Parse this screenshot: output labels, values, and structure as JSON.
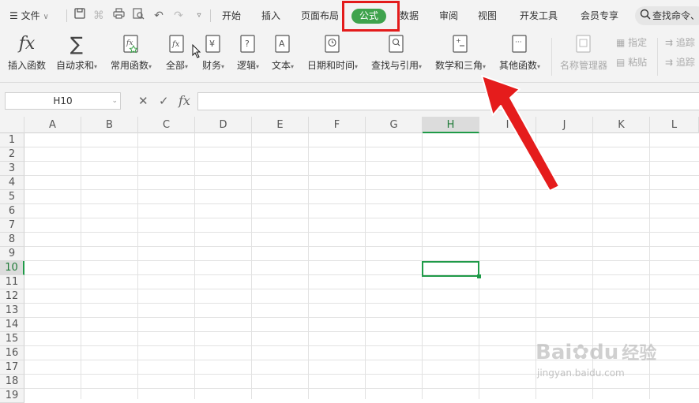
{
  "menubar": {
    "file_label": "文件",
    "tabs": [
      "开始",
      "插入",
      "页面布局",
      "公式",
      "数据",
      "审阅",
      "视图",
      "开发工具",
      "会员专享"
    ],
    "active_tab": "公式",
    "search_placeholder": "查找命令、"
  },
  "ribbon": {
    "groups": [
      {
        "label": "插入函数",
        "icon": "fx-icon"
      },
      {
        "label": "自动求和",
        "icon": "sigma-icon"
      },
      {
        "label": "常用函数",
        "icon": "star-function-icon"
      },
      {
        "label": "全部",
        "icon": "fx-book-icon"
      },
      {
        "label": "财务",
        "icon": "yen-book-icon"
      },
      {
        "label": "逻辑",
        "icon": "question-book-icon"
      },
      {
        "label": "文本",
        "icon": "letter-a-book-icon"
      },
      {
        "label": "日期和时间",
        "icon": "clock-book-icon"
      },
      {
        "label": "查找与引用",
        "icon": "search-book-icon"
      },
      {
        "label": "数学和三角",
        "icon": "math-book-icon"
      },
      {
        "label": "其他函数",
        "icon": "dots-book-icon"
      }
    ],
    "name_manager": "名称管理器",
    "specify": "指定",
    "paste": "粘贴",
    "trace1": "追踪",
    "trace2": "追踪"
  },
  "formula_bar": {
    "name_box": "H10",
    "cancel_symbol": "✕",
    "confirm_symbol": "✓",
    "fx_symbol": "fx",
    "formula": ""
  },
  "sheet": {
    "columns": [
      "A",
      "B",
      "C",
      "D",
      "E",
      "F",
      "G",
      "H",
      "I",
      "J",
      "K",
      "L"
    ],
    "rows": [
      "1",
      "2",
      "3",
      "4",
      "5",
      "6",
      "7",
      "8",
      "9",
      "10",
      "11",
      "12",
      "13",
      "14",
      "15",
      "16",
      "17",
      "18",
      "19"
    ],
    "selected_column": "H",
    "selected_row": "10"
  },
  "watermark": {
    "brand": "Bai",
    "brand2": "du",
    "cn": "经验",
    "url": "jingyan.baidu.com"
  },
  "colors": {
    "accent_green": "#3fa34d",
    "annotation_red": "#e31b1b"
  }
}
